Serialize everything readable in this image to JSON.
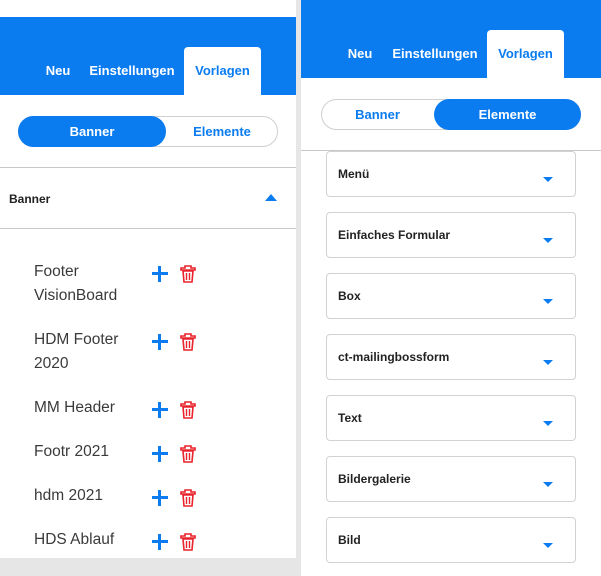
{
  "colors": {
    "primary": "#0b7cf0",
    "danger": "#e8232b",
    "background": "#e6e6e6"
  },
  "left_panel": {
    "tabs": [
      {
        "label": "Neu"
      },
      {
        "label": "Einstellungen"
      },
      {
        "label": "Vorlagen",
        "active": true
      }
    ],
    "toggle": {
      "left": "Banner",
      "right": "Elemente",
      "selected": "Banner"
    },
    "section_title": "Banner",
    "templates": [
      {
        "name": "Footer VisionBoard"
      },
      {
        "name": "HDM Footer 2020"
      },
      {
        "name": "MM Header"
      },
      {
        "name": "Footr 2021"
      },
      {
        "name": "hdm 2021"
      },
      {
        "name": "HDS Ablauf"
      }
    ],
    "icons": {
      "add": "plus-icon",
      "delete": "trash-icon",
      "collapse": "caret-up-icon"
    }
  },
  "right_panel": {
    "tabs": [
      {
        "label": "Neu"
      },
      {
        "label": "Einstellungen"
      },
      {
        "label": "Vorlagen",
        "active": true
      }
    ],
    "toggle": {
      "left": "Banner",
      "right": "Elemente",
      "selected": "Elemente"
    },
    "elements": [
      {
        "label": "Menü"
      },
      {
        "label": "Einfaches Formular"
      },
      {
        "label": "Box"
      },
      {
        "label": "ct-mailingbossform"
      },
      {
        "label": "Text"
      },
      {
        "label": "Bildergalerie"
      },
      {
        "label": "Bild"
      }
    ],
    "icons": {
      "expand": "caret-down-icon"
    }
  }
}
